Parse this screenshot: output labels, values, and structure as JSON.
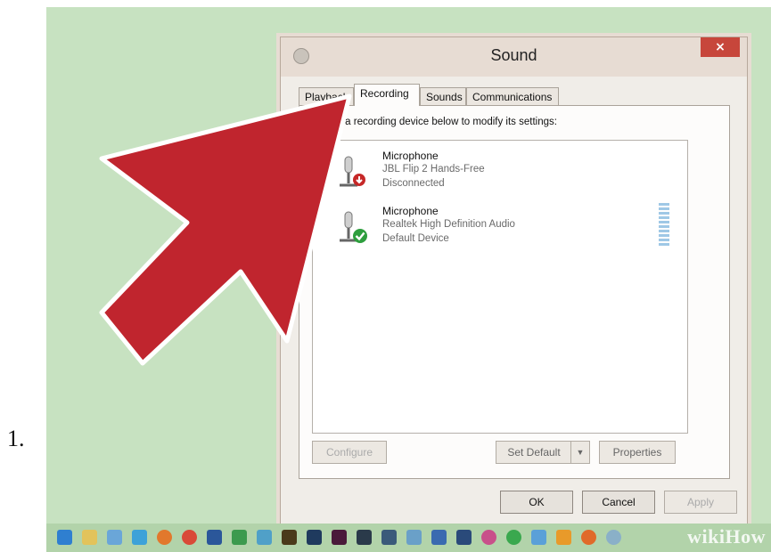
{
  "step": {
    "number": "1."
  },
  "dialog": {
    "title": "Sound",
    "close_label": "×",
    "tabs": [
      {
        "label": "Playback",
        "active": false
      },
      {
        "label": "Recording",
        "active": true
      },
      {
        "label": "Sounds",
        "active": false
      },
      {
        "label": "Communications",
        "active": false
      }
    ],
    "instruction": "Select a recording device below to modify its settings:",
    "devices": [
      {
        "name": "Microphone",
        "driver": "JBL Flip 2 Hands-Free",
        "status": "Disconnected",
        "status_icon": "red-down-arrow-icon"
      },
      {
        "name": "Microphone",
        "driver": "Realtek High Definition Audio",
        "status": "Default Device",
        "status_icon": "green-check-icon"
      }
    ],
    "buttons": {
      "configure": "Configure",
      "set_default": "Set Default",
      "properties": "Properties",
      "ok": "OK",
      "cancel": "Cancel",
      "apply": "Apply"
    }
  },
  "watermark": {
    "wiki": "wiki",
    "how": "How"
  },
  "colors": {
    "background": "#c7e2c1",
    "arrow_fill": "#c0252e",
    "arrow_stroke": "#ffffff",
    "close_button": "#c7463b"
  }
}
